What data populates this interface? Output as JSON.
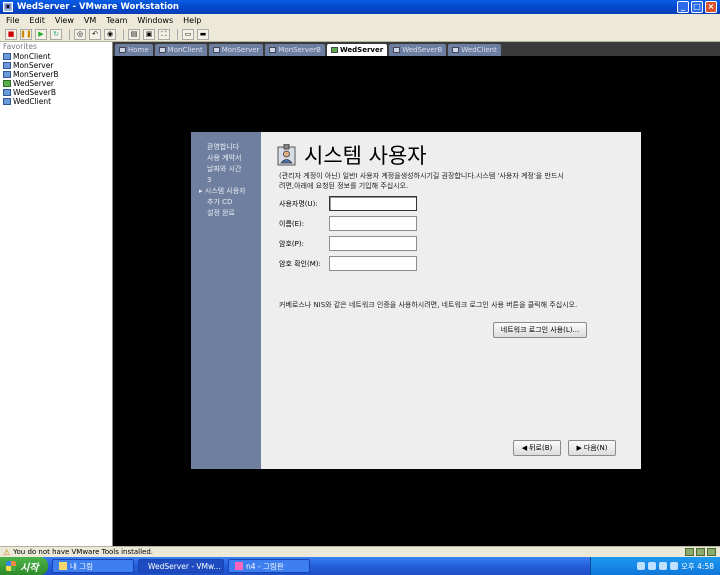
{
  "window": {
    "title": "WedServer - VMware Workstation"
  },
  "menu": [
    "File",
    "Edit",
    "View",
    "VM",
    "Team",
    "Windows",
    "Help"
  ],
  "favorites": {
    "header": "Favorites",
    "items": [
      "MonClient",
      "MonServer",
      "MonServerB",
      "WedServer",
      "WedSeverB",
      "WedClient"
    ]
  },
  "tabs": [
    "Home",
    "MonClient",
    "MonServer",
    "MonServerB",
    "WedServer",
    "WedSeverB",
    "WedClient"
  ],
  "installer": {
    "steps": [
      "환영합니다",
      "사용 계약서",
      "날짜와 시간",
      "3",
      "시스템 사용자",
      "추가 CD",
      "설정 완료"
    ],
    "title": "시스템 사용자",
    "description": "(관리자 계정이 아닌) 일반I 사용자 계정을생성하시기길 권장합니다.시스템 '사용자 계정'을 만드시려면,아래에 요청된 정보를 기입해 주십시오.",
    "fields": [
      {
        "label": "사용자명(U):",
        "value": ""
      },
      {
        "label": "이름(E):",
        "value": ""
      },
      {
        "label": "암호(P):",
        "value": ""
      },
      {
        "label": "암호 확인(M):",
        "value": ""
      }
    ],
    "note": "커베로스나 NIS와 같은 네트워크 인증을 사용하시려면, 네트워크 로그인 사용 버튼을 클릭해 주십시오.",
    "network_button": "네트워크 로그인 사용(L)...",
    "back_button": "뒤로(B)",
    "next_button": "다음(N)"
  },
  "status": {
    "message": "You do not have VMware Tools installed."
  },
  "taskbar": {
    "start": "시작",
    "tasks": [
      "내 그림",
      "WedServer - VMw...",
      "n4 - 그림판"
    ],
    "clock": "오후 4:58"
  }
}
